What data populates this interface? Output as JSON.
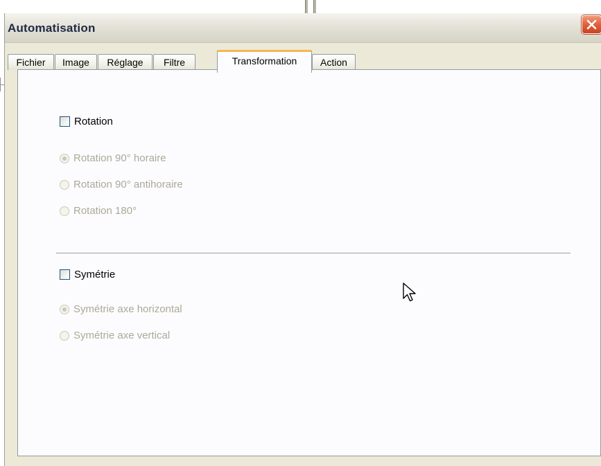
{
  "window": {
    "title": "Automatisation"
  },
  "tabs": [
    {
      "label": "Fichier",
      "active": false
    },
    {
      "label": "Image",
      "active": false
    },
    {
      "label": "Réglage",
      "active": false
    },
    {
      "label": "Filtre",
      "active": false
    },
    {
      "label": "Transformation",
      "active": true
    },
    {
      "label": "Action",
      "active": false
    }
  ],
  "rotation": {
    "checkbox_label": "Rotation",
    "checked": false,
    "options": [
      {
        "label": "Rotation 90° horaire",
        "selected": true,
        "enabled": false
      },
      {
        "label": "Rotation 90° antihoraire",
        "selected": false,
        "enabled": false
      },
      {
        "label": "Rotation 180°",
        "selected": false,
        "enabled": false
      }
    ]
  },
  "symetrie": {
    "checkbox_label": "Symétrie",
    "checked": false,
    "options": [
      {
        "label": "Symétrie axe horizontal",
        "selected": true,
        "enabled": false
      },
      {
        "label": "Symétrie axe vertical",
        "selected": false,
        "enabled": false
      }
    ]
  },
  "colors": {
    "active_tab_accent": "#f6b84a",
    "close_button": "#e0603d",
    "disabled_text": "#aca899",
    "dialog_face": "#ece9d8"
  },
  "icons": {
    "close": "close-icon",
    "cursor": "mouse-pointer-icon"
  }
}
